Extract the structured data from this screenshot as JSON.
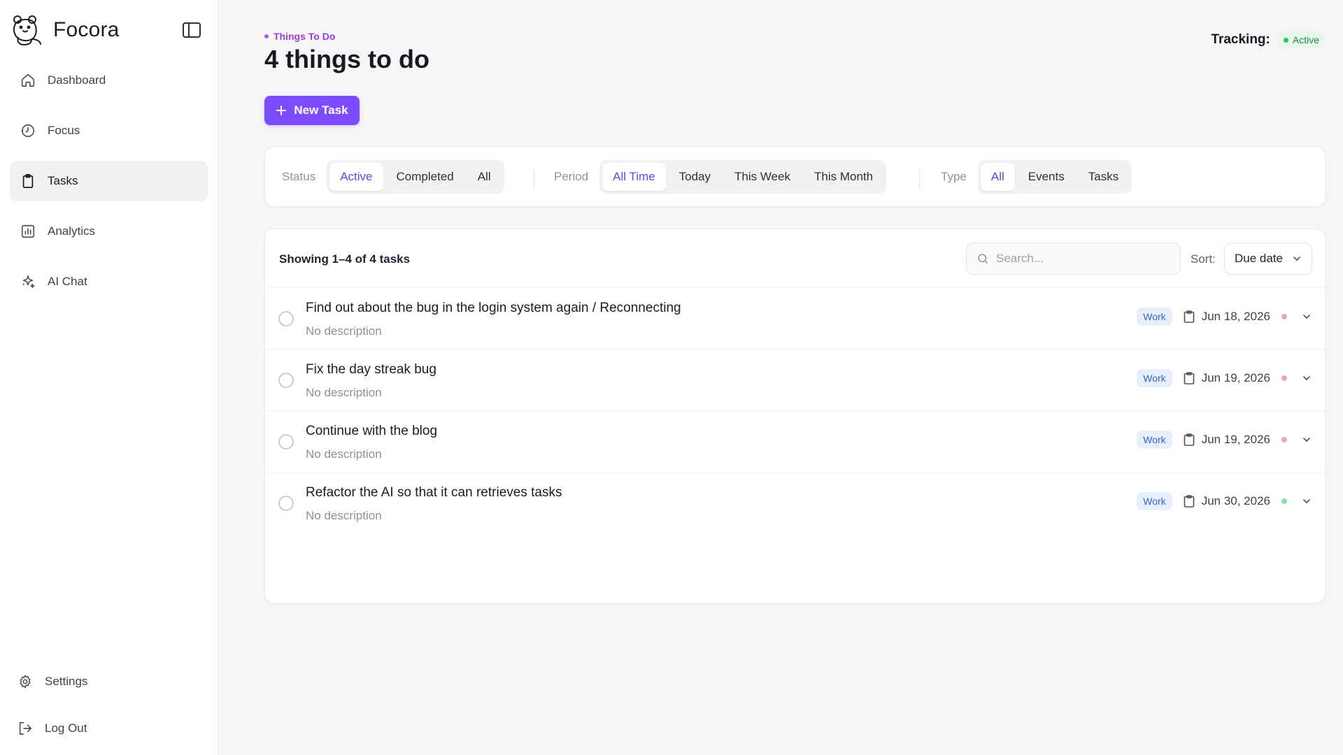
{
  "app": {
    "name": "Focora"
  },
  "sidebar": {
    "items": [
      {
        "label": "Dashboard",
        "icon": "home-icon",
        "active": false
      },
      {
        "label": "Focus",
        "icon": "timer-icon",
        "active": false
      },
      {
        "label": "Tasks",
        "icon": "clipboard-icon",
        "active": true
      },
      {
        "label": "Analytics",
        "icon": "bar-chart-icon",
        "active": false
      },
      {
        "label": "AI Chat",
        "icon": "sparkle-icon",
        "active": false
      }
    ],
    "bottom": [
      {
        "label": "Settings",
        "icon": "gear-icon"
      },
      {
        "label": "Log Out",
        "icon": "logout-icon"
      }
    ]
  },
  "header": {
    "eyebrow": "Things To Do",
    "title": "4 things to do",
    "tracking_label": "Tracking:",
    "tracking_status": "Active"
  },
  "toolbar": {
    "new_task_label": "New Task"
  },
  "filters": {
    "status": {
      "label": "Status",
      "options": [
        "Active",
        "Completed",
        "All"
      ],
      "selected": "Active"
    },
    "period": {
      "label": "Period",
      "options": [
        "All Time",
        "Today",
        "This Week",
        "This Month"
      ],
      "selected": "All Time"
    },
    "type": {
      "label": "Type",
      "options": [
        "All",
        "Events",
        "Tasks"
      ],
      "selected": "All"
    }
  },
  "list": {
    "showing": "Showing 1–4 of 4 tasks",
    "search_placeholder": "Search...",
    "sort_label": "Sort:",
    "sort_value": "Due date",
    "tasks": [
      {
        "title": "Find out about the bug in the login system again / Reconnecting",
        "description": "No description",
        "tag": "Work",
        "date": "Jun 18, 2026",
        "priority_color": "#f6a5a5"
      },
      {
        "title": "Fix the day streak bug",
        "description": "No description",
        "tag": "Work",
        "date": "Jun 19, 2026",
        "priority_color": "#f6a5a5"
      },
      {
        "title": "Continue with the blog",
        "description": "No description",
        "tag": "Work",
        "date": "Jun 19, 2026",
        "priority_color": "#f6a5a5"
      },
      {
        "title": "Refactor the AI so that it can retrieves tasks",
        "description": "No description",
        "tag": "Work",
        "date": "Jun 30, 2026",
        "priority_color": "#86e0a2"
      }
    ]
  },
  "colors": {
    "accent": "#7c4dff",
    "eyebrow": "#a13ad9",
    "active_green": "#22c55e",
    "tag_bg": "#e6eefc",
    "tag_text": "#3566c9"
  }
}
